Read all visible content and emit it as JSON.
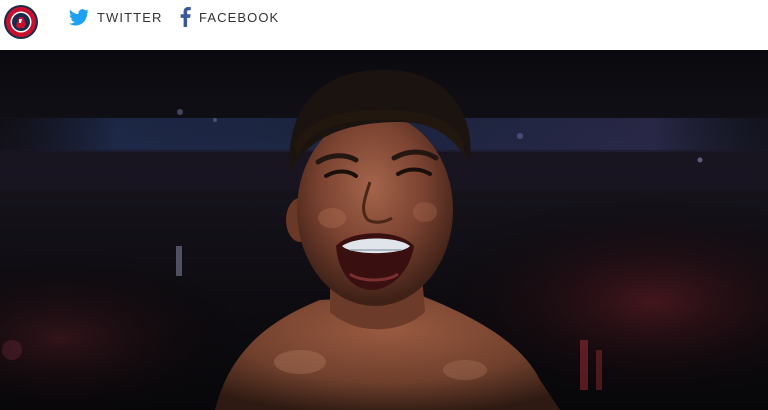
{
  "share": {
    "twitter_label": "TWITTER",
    "facebook_label": "FACEBOOK"
  },
  "icons": {
    "logo": "site-logo",
    "twitter": "twitter-bird-icon",
    "facebook": "facebook-f-icon"
  },
  "colors": {
    "twitter": "#1da1f2",
    "facebook": "#3b5998",
    "logo_red": "#c8102e",
    "logo_navy": "#1b2a4a",
    "text": "#333333"
  }
}
